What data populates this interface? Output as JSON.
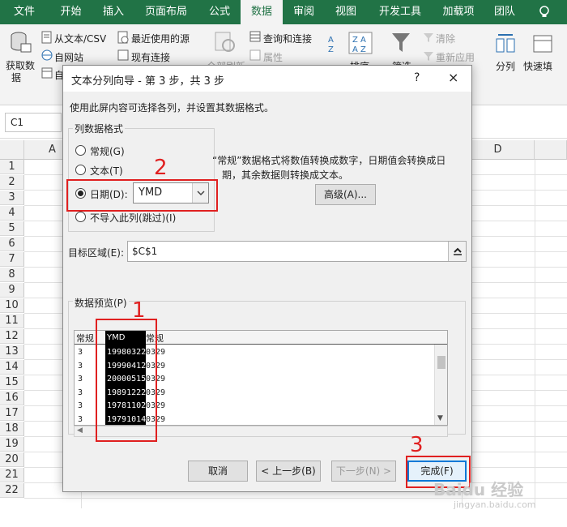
{
  "ribbon_tabs": [
    "文件",
    "开始",
    "插入",
    "页面布局",
    "公式",
    "数据",
    "审阅",
    "视图",
    "开发工具",
    "加载项",
    "团队"
  ],
  "active_tab": "数据",
  "ribbon": {
    "get_data": "获取数",
    "get_data2": "据",
    "from_text_csv": "从文本/CSV",
    "from_web": "自网站",
    "from_table": "自",
    "recent_sources": "最近使用的源",
    "existing_connections": "现有连接",
    "refresh_all": "全部刷新",
    "queries_connections": "查询和连接",
    "properties": "属性",
    "sort": "排序",
    "filter": "筛选",
    "clear": "清除",
    "reapply": "重新应用",
    "split": "分列",
    "flash_fill": "快速填"
  },
  "namebox": "C1",
  "columns": [
    "A",
    "D"
  ],
  "rows": [
    "1",
    "2",
    "3",
    "4",
    "5",
    "6",
    "7",
    "8",
    "9",
    "10",
    "11",
    "12",
    "13",
    "14",
    "15",
    "16",
    "17",
    "18",
    "19",
    "20",
    "21",
    "22"
  ],
  "dialog": {
    "title": "文本分列向导 - 第 3 步，共 3 步",
    "help": "?",
    "close": "×",
    "intro": "使用此屏内容可选择各列，并设置其数据格式。",
    "group_label": "列数据格式",
    "opt_general": "常规(G)",
    "opt_text": "文本(T)",
    "opt_date": "日期(D):",
    "opt_skip": "不导入此列(跳过)(I)",
    "date_format": "YMD",
    "desc_line1": "“常规”数据格式将数值转换成数字，日期值会转换成日",
    "desc_line2": "期，其余数据则转换成文本。",
    "advanced": "高级(A)...",
    "dest_label": "目标区域(E):",
    "dest_value": "$C$1",
    "preview_label": "数据预览(P)",
    "preview_headers": [
      "常规",
      "YMD",
      "常规"
    ],
    "preview_rows": [
      [
        "3",
        "19980322",
        "0329"
      ],
      [
        "3",
        "19990412",
        "0329"
      ],
      [
        "3",
        "20000515",
        "0329"
      ],
      [
        "3",
        "19891222",
        "0329"
      ],
      [
        "3",
        "19781102",
        "0329"
      ],
      [
        "3",
        "19791014",
        "0329"
      ]
    ],
    "cancel": "取消",
    "back": "< 上一步(B)",
    "next": "下一步(N) >",
    "finish": "完成(F)"
  },
  "annotations": [
    "1",
    "2",
    "3"
  ],
  "watermark": "Baidu 经验",
  "watermark_url": "jingyan.baidu.com",
  "colors": {
    "excel_green": "#217346",
    "annotation_red": "#e02020",
    "default_button_border": "#0078d7"
  }
}
